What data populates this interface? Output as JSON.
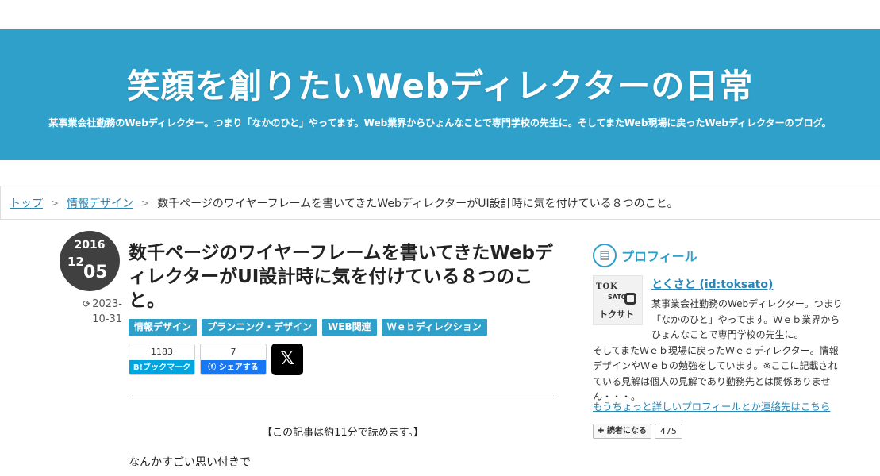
{
  "header": {
    "blog_title": "笑顔を創りたいWebディレクターの日常",
    "blog_description": "某事業会社勤務のWebディレクター。つまり「なかのひと」やってます。Web業界からひょんなことで専門学校の先生に。そしてまたWeb現場に戻ったWebディレクターのブログ。"
  },
  "breadcrumb": {
    "home": "トップ",
    "separator": ">",
    "category": "情報デザイン",
    "current": "数千ページのワイヤーフレームを書いてきたWebディレクターがUI設計時に気を付けている８つのこと。"
  },
  "entry": {
    "date": {
      "year": "2016",
      "month": "12",
      "day": "05"
    },
    "updated_icon": "sync-icon",
    "updated_line1": "2023-",
    "updated_line2": "10-31",
    "title": "数千ページのワイヤーフレームを書いてきたWebディレクターがUI設計時に気を付けている８つのこと。",
    "categories": [
      "情報デザイン",
      "プランニング・デザイン",
      "WEB関連",
      "Ｗｅｂディレクション"
    ],
    "social": {
      "hatena_count": "1183",
      "hatena_label": "B!ブックマーク",
      "facebook_count": "7",
      "facebook_label": "シェアする",
      "x_label": "𝕏"
    },
    "read_time": "【この記事は約11分で読めます。】",
    "body_first_line": "なんかすごい思い付きで"
  },
  "sidebar": {
    "heading": "プロフィール",
    "profile_name": "とくさと (id:toksato)",
    "avatar": {
      "line1": "TOK",
      "line2": "SATO",
      "line3": "トクサト"
    },
    "description_first": "某事業会社勤務のWebディレクター。つまり「なかのひと」やってます。Ｗｅｂ業界からひょんなことで専門学校の先生に。",
    "description_rest": "そしてまたＷｅｂ現場に戻ったＷｅｄディレクター。情報デザインやＷｅｂの勉強をしています。※ここに記載されている見解は個人の見解であり勤務先とは関係ありません・・・。",
    "profile_link": "もうちょっと詳しいプロフィールとか連絡先はこちら",
    "subscribe_label": "✚ 読者になる",
    "subscriber_count": "475"
  },
  "colors": {
    "header_bg": "#2fa0ca",
    "link": "#2a86b5",
    "date_circle": "#404040",
    "hatena": "#00a4de",
    "facebook": "#1877f2"
  }
}
